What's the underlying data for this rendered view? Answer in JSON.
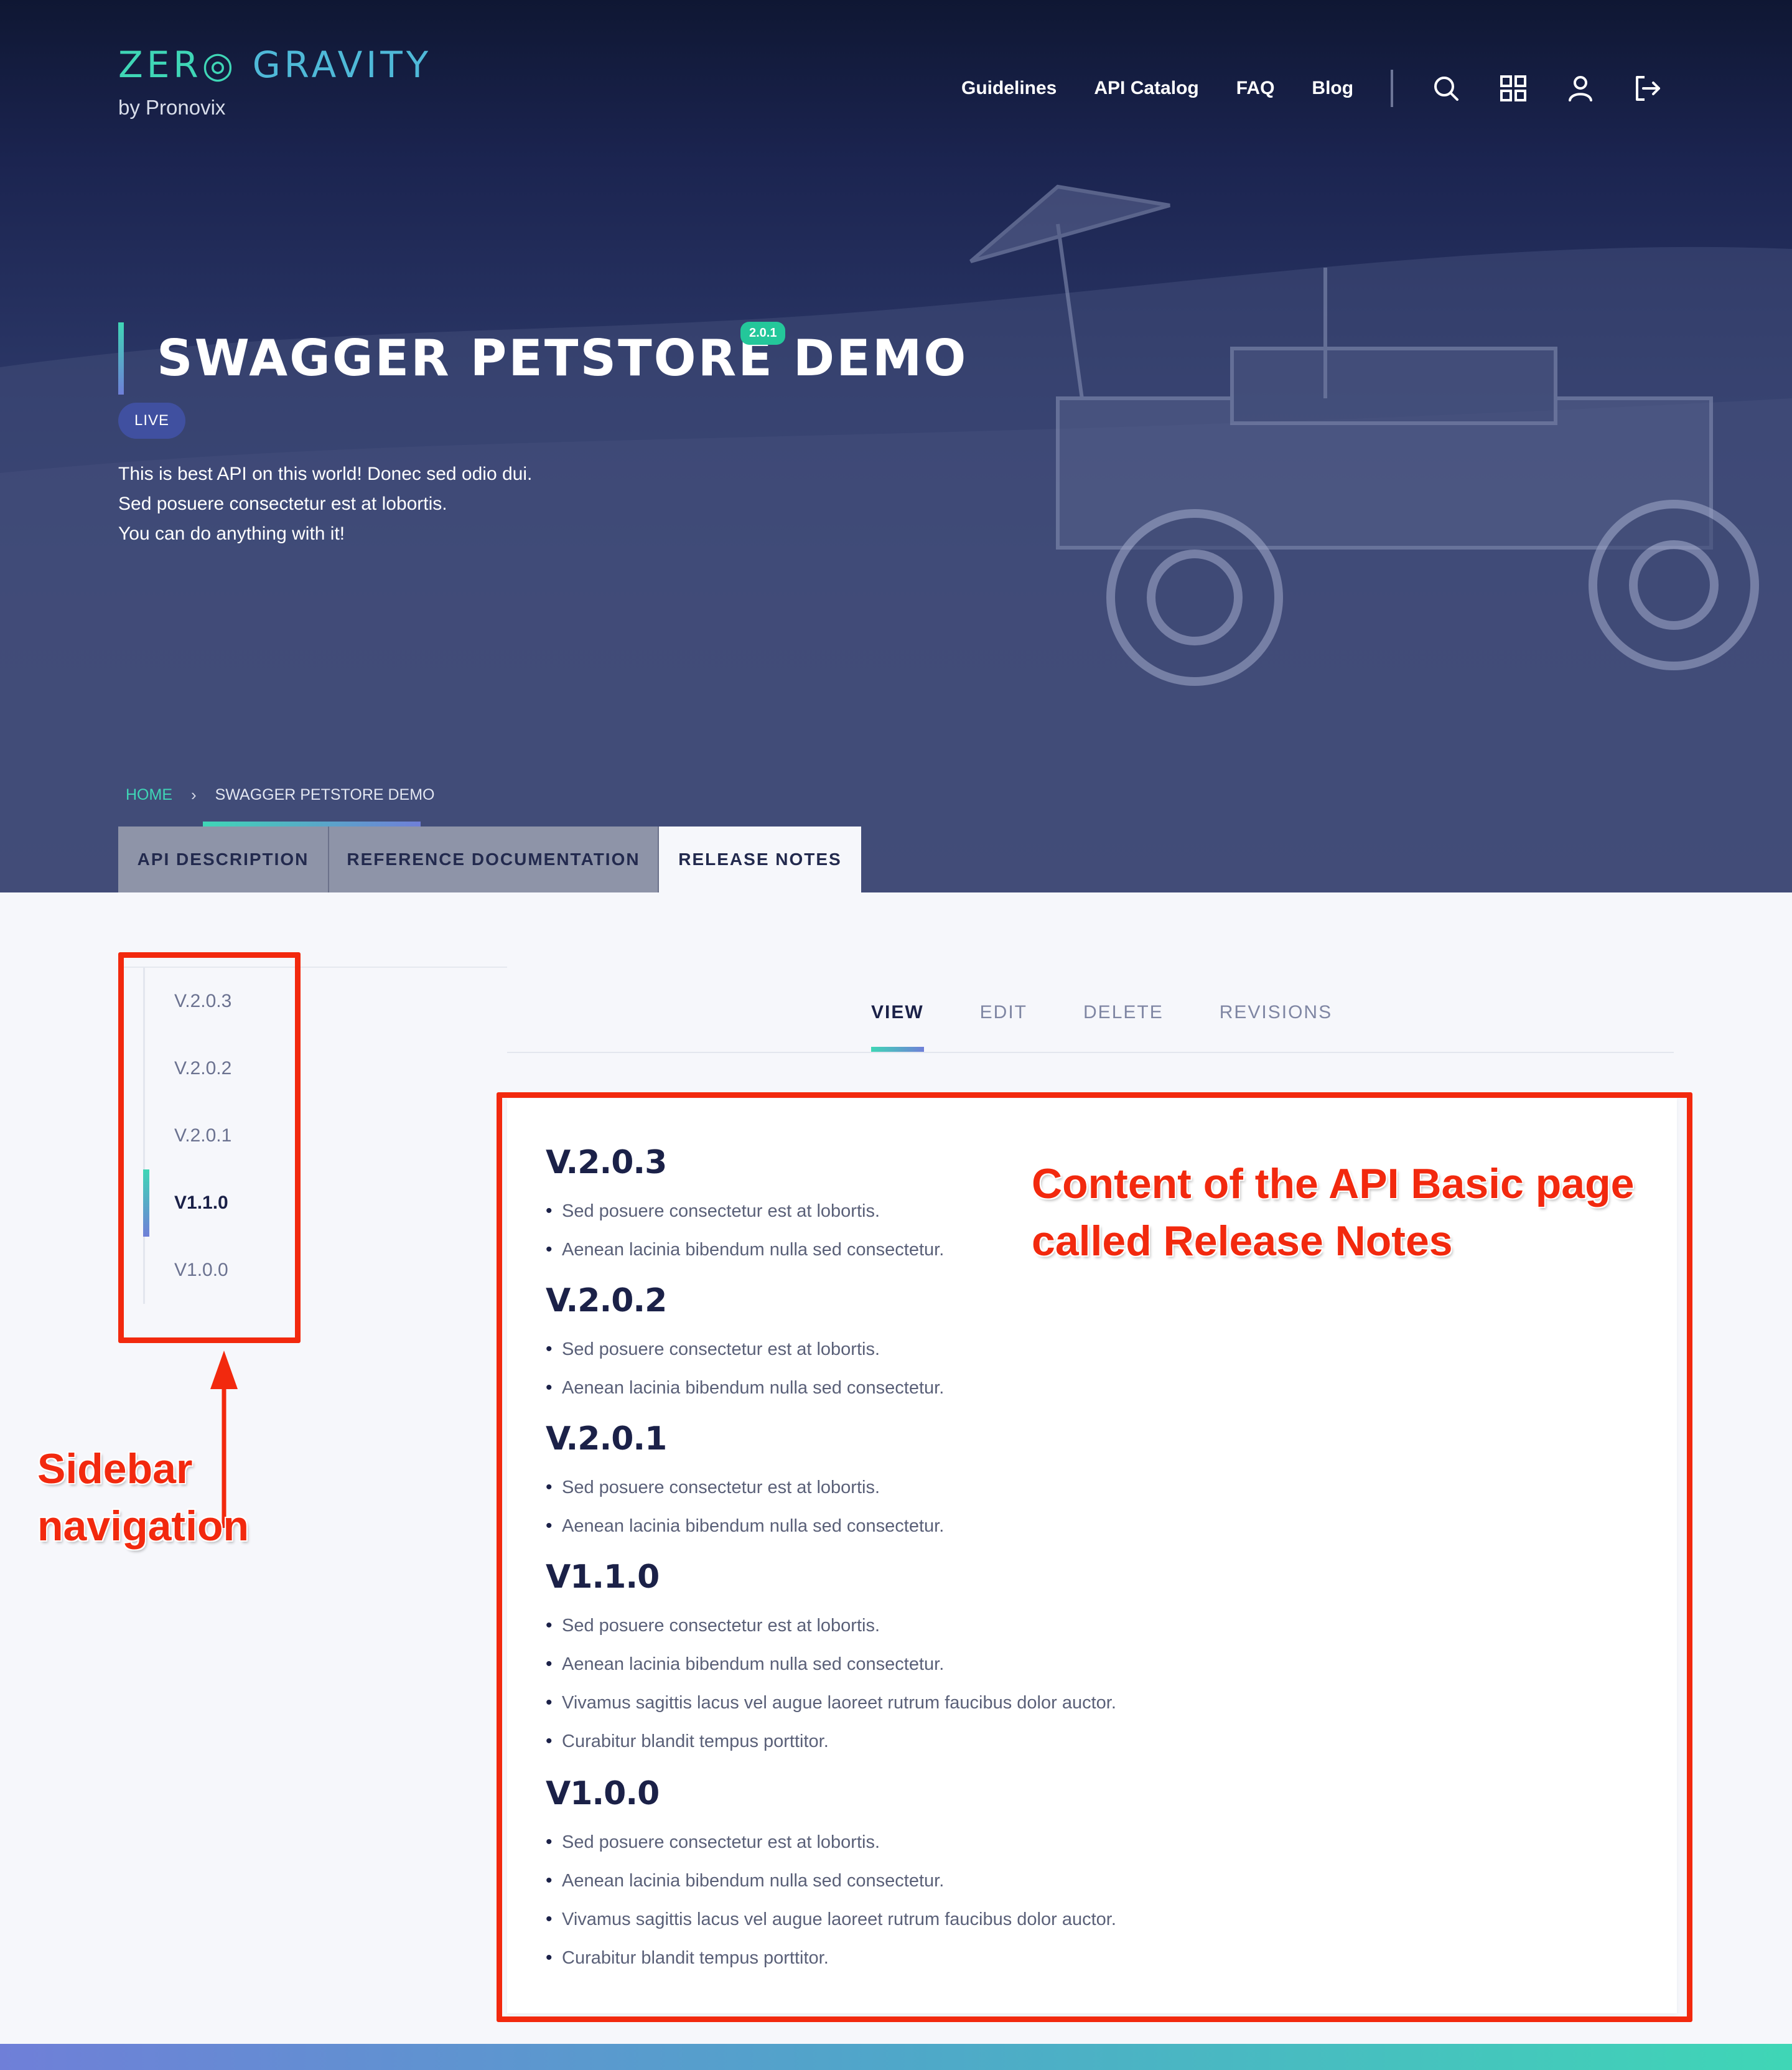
{
  "brand": {
    "logo_word1": "ZER◎",
    "logo_word2": "GRAVITY",
    "sub": "by Pronovix"
  },
  "topnav": {
    "links": [
      "Guidelines",
      "API Catalog",
      "FAQ",
      "Blog"
    ],
    "icons": [
      "search-icon",
      "grid-icon",
      "user-icon",
      "logout-icon"
    ]
  },
  "api": {
    "title": "SWAGGER PETSTORE DEMO",
    "version": "2.0.1",
    "status": "LIVE",
    "description": [
      "This is best API on this world! Donec sed odio dui.",
      "Sed posuere consectetur est at lobortis.",
      "You can do anything with it!"
    ]
  },
  "breadcrumb": {
    "home": "HOME",
    "separator": "›",
    "current": "SWAGGER PETSTORE DEMO"
  },
  "page_tabs": [
    "API DESCRIPTION",
    "REFERENCE DOCUMENTATION",
    "RELEASE NOTES"
  ],
  "page_tabs_active": "RELEASE NOTES",
  "sidebar": {
    "items": [
      "V.2.0.3",
      "V.2.0.2",
      "V.2.0.1",
      "V1.1.0",
      "V1.0.0"
    ],
    "active": "V1.1.0"
  },
  "content_tabs": [
    "VIEW",
    "EDIT",
    "DELETE",
    "REVISIONS"
  ],
  "content_tabs_active": "VIEW",
  "releases": [
    {
      "version": "V.2.0.3",
      "notes": [
        "Sed posuere consectetur est at lobortis.",
        "Aenean lacinia bibendum nulla sed consectetur."
      ]
    },
    {
      "version": "V.2.0.2",
      "notes": [
        "Sed posuere consectetur est at lobortis.",
        "Aenean lacinia bibendum nulla sed consectetur."
      ]
    },
    {
      "version": "V.2.0.1",
      "notes": [
        "Sed posuere consectetur est at lobortis.",
        "Aenean lacinia bibendum nulla sed consectetur."
      ]
    },
    {
      "version": "V1.1.0",
      "notes": [
        "Sed posuere consectetur est at lobortis.",
        "Aenean lacinia bibendum nulla sed consectetur.",
        "Vivamus sagittis lacus vel augue laoreet rutrum faucibus dolor auctor.",
        "Curabitur blandit tempus porttitor."
      ]
    },
    {
      "version": "V1.0.0",
      "notes": [
        "Sed posuere consectetur est at lobortis.",
        "Aenean lacinia bibendum nulla sed consectetur.",
        "Vivamus sagittis lacus vel augue laoreet rutrum faucibus dolor auctor.",
        "Curabitur blandit tempus porttitor."
      ]
    }
  ],
  "annotations": {
    "content_label_line1": "Content of the API Basic page",
    "content_label_line2": "called Release Notes",
    "sidebar_label_line1": "Sidebar",
    "sidebar_label_line2": "navigation"
  },
  "colors": {
    "accent_teal": "#3fd6b6",
    "accent_purple": "#6f7fd8",
    "annotation_red": "#f2290e",
    "hero_navy": "#1b2450",
    "version_badge": "#24c79a",
    "live_badge": "#4050a0"
  }
}
